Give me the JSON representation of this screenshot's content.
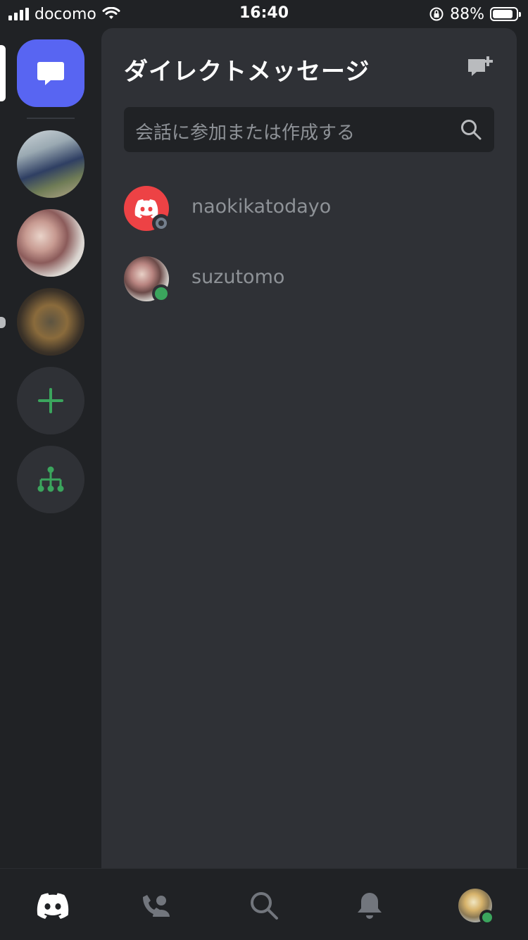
{
  "status_bar": {
    "carrier": "docomo",
    "time": "16:40",
    "battery_percent": "88%",
    "battery_level": 0.88
  },
  "sidebar": {
    "items": [
      {
        "name": "direct-messages",
        "icon": "chat-bubble-icon",
        "selected": true
      },
      {
        "name": "server-1",
        "icon": "server-avatar"
      },
      {
        "name": "server-2",
        "icon": "server-avatar"
      },
      {
        "name": "server-3",
        "icon": "server-avatar",
        "unread": true
      },
      {
        "name": "add-server",
        "icon": "plus-icon"
      },
      {
        "name": "explore-servers",
        "icon": "hierarchy-icon"
      }
    ]
  },
  "main": {
    "title": "ダイレクトメッセージ",
    "new_dm_icon": "new-message-icon",
    "search": {
      "placeholder": "会話に参加または作成する"
    },
    "dms": [
      {
        "name": "naokikatodayo",
        "status": "offline"
      },
      {
        "name": "suzutomo",
        "status": "online"
      }
    ]
  },
  "tabbar": {
    "tabs": [
      "home-icon",
      "friends-icon",
      "search-icon",
      "notifications-icon",
      "profile-avatar"
    ]
  },
  "colors": {
    "accent": "#5865f2",
    "green": "#3ba55d",
    "red": "#ed4245",
    "panel": "#2f3136",
    "rail": "#202225"
  }
}
